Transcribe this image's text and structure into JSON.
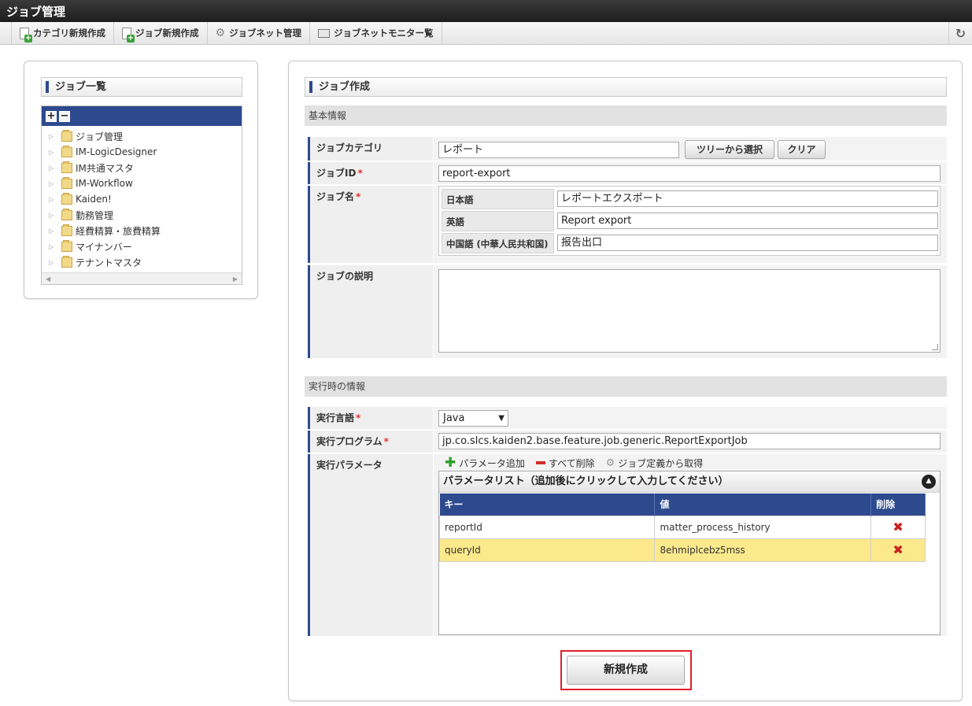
{
  "app_title": "ジョブ管理",
  "toolbar": {
    "items": [
      {
        "label": "カテゴリ新規作成",
        "icon": "new-doc-icon"
      },
      {
        "label": "ジョブ新規作成",
        "icon": "new-doc-icon"
      },
      {
        "label": "ジョブネット管理",
        "icon": "gear-icon"
      },
      {
        "label": "ジョブネットモニター覧",
        "icon": "monitor-icon"
      }
    ],
    "refresh_icon": "refresh-icon"
  },
  "left_panel": {
    "title": "ジョブ一覧",
    "expand_all": "+",
    "collapse_all": "−",
    "tree": [
      "ジョブ管理",
      "IM-LogicDesigner",
      "IM共通マスタ",
      "IM-Workflow",
      "Kaiden!",
      "勤務管理",
      "経費精算・旅費精算",
      "マイナンバー",
      "テナントマスタ"
    ]
  },
  "right_panel": {
    "title": "ジョブ作成",
    "basic_info": "基本情報",
    "job_category": {
      "label": "ジョブカテゴリ",
      "value": "レポート",
      "tree_select_button": "ツリーから選択",
      "clear_button": "クリア"
    },
    "job_id": {
      "label": "ジョブID",
      "required": "*",
      "value": "report-export"
    },
    "job_name": {
      "label": "ジョブ名",
      "required": "*",
      "langs": [
        {
          "lang": "日本語",
          "value": "レポートエクスポート"
        },
        {
          "lang": "英語",
          "value": "Report export"
        },
        {
          "lang": "中国語 (中華人民共和国)",
          "value": "报告出口"
        }
      ]
    },
    "job_description": {
      "label": "ジョブの説明",
      "value": ""
    },
    "runtime_info": "実行時の情報",
    "exec_language": {
      "label": "実行言語",
      "required": "*",
      "value": "Java"
    },
    "exec_program": {
      "label": "実行プログラム",
      "required": "*",
      "value": "jp.co.slcs.kaiden2.base.feature.job.generic.ReportExportJob"
    },
    "exec_params": {
      "label": "実行パラメータ",
      "add_param": "パラメータ追加",
      "delete_all": "すべて削除",
      "from_job_def": "ジョブ定義から取得",
      "list_title": "パラメータリスト（追加後にクリックして入力してください）",
      "columns": [
        "キー",
        "値",
        "削除"
      ],
      "rows": [
        {
          "key": "reportId",
          "value": "matter_process_history",
          "selected": false
        },
        {
          "key": "queryId",
          "value": "8ehmiplcebz5mss",
          "selected": true
        }
      ]
    },
    "create_button": "新規作成"
  }
}
